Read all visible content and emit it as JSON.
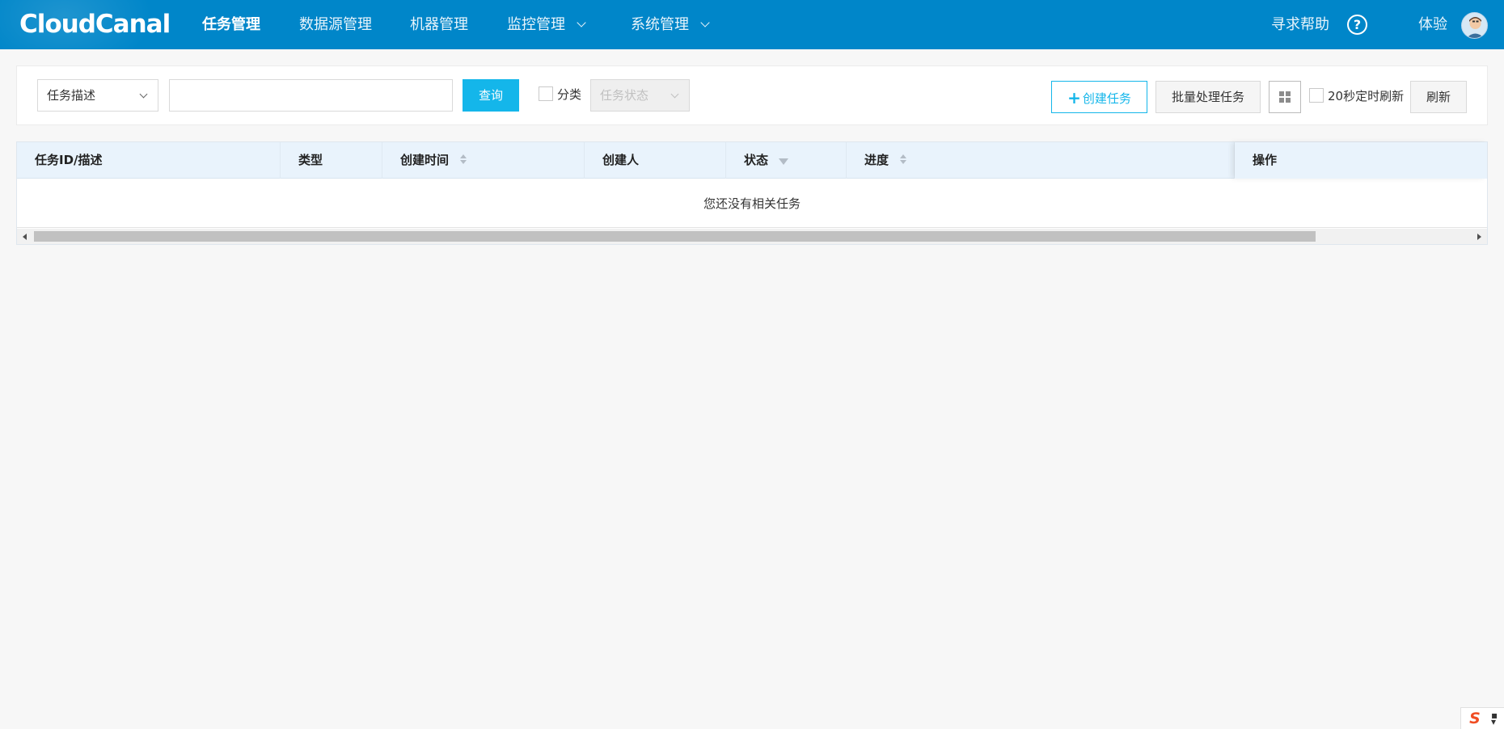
{
  "app": {
    "logo_text": "CloudCanal"
  },
  "nav": {
    "items": [
      {
        "label": "任务管理",
        "active": true
      },
      {
        "label": "数据源管理"
      },
      {
        "label": "机器管理"
      },
      {
        "label": "监控管理",
        "has_dropdown": true
      },
      {
        "label": "系统管理",
        "has_dropdown": true
      }
    ],
    "help_label": "寻求帮助",
    "help_icon_glyph": "?",
    "user_name": "体验"
  },
  "toolbar": {
    "search_field_select": "任务描述",
    "search_input_value": "",
    "query_button": "查询",
    "classify_label": "分类",
    "status_select_placeholder": "任务状态",
    "create_button": "创建任务",
    "batch_button": "批量处理任务",
    "auto_refresh_label": "20秒定时刷新",
    "refresh_button": "刷新"
  },
  "table": {
    "columns": [
      {
        "label": "任务ID/描述"
      },
      {
        "label": "类型"
      },
      {
        "label": "创建时间",
        "sortable": true
      },
      {
        "label": "创建人"
      },
      {
        "label": "状态",
        "filterable": true
      },
      {
        "label": "进度",
        "sortable": true
      },
      {
        "label": "操作"
      }
    ],
    "empty_text": "您还没有相关任务"
  },
  "ime": {
    "glyph": "S"
  },
  "colors": {
    "nav_bg": "#0086c9",
    "accent": "#14b6ea",
    "table_header_bg": "#e9f3fc",
    "page_bg": "#f7f7f7"
  }
}
